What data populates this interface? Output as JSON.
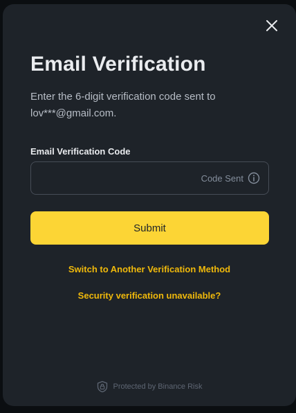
{
  "modal": {
    "title": "Email Verification",
    "description": "Enter the 6-digit verification code sent to lov***@gmail.com.",
    "close_icon": "close-icon"
  },
  "form": {
    "field_label": "Email Verification Code",
    "input_value": "",
    "input_placeholder": "",
    "code_status": "Code Sent",
    "info_icon": "info-icon",
    "submit_label": "Submit"
  },
  "links": {
    "switch_method": "Switch to Another Verification Method",
    "unavailable": "Security verification unavailable?"
  },
  "footer": {
    "text": "Protected by Binance Risk",
    "icon": "shield-lock-icon"
  },
  "colors": {
    "background": "#0b0e11",
    "modal": "#1e2329",
    "primary_text": "#eaecef",
    "secondary_text": "#b7bdc6",
    "muted_text": "#848e9c",
    "accent": "#fcd535",
    "link": "#f0b90b",
    "border": "#474d57"
  }
}
